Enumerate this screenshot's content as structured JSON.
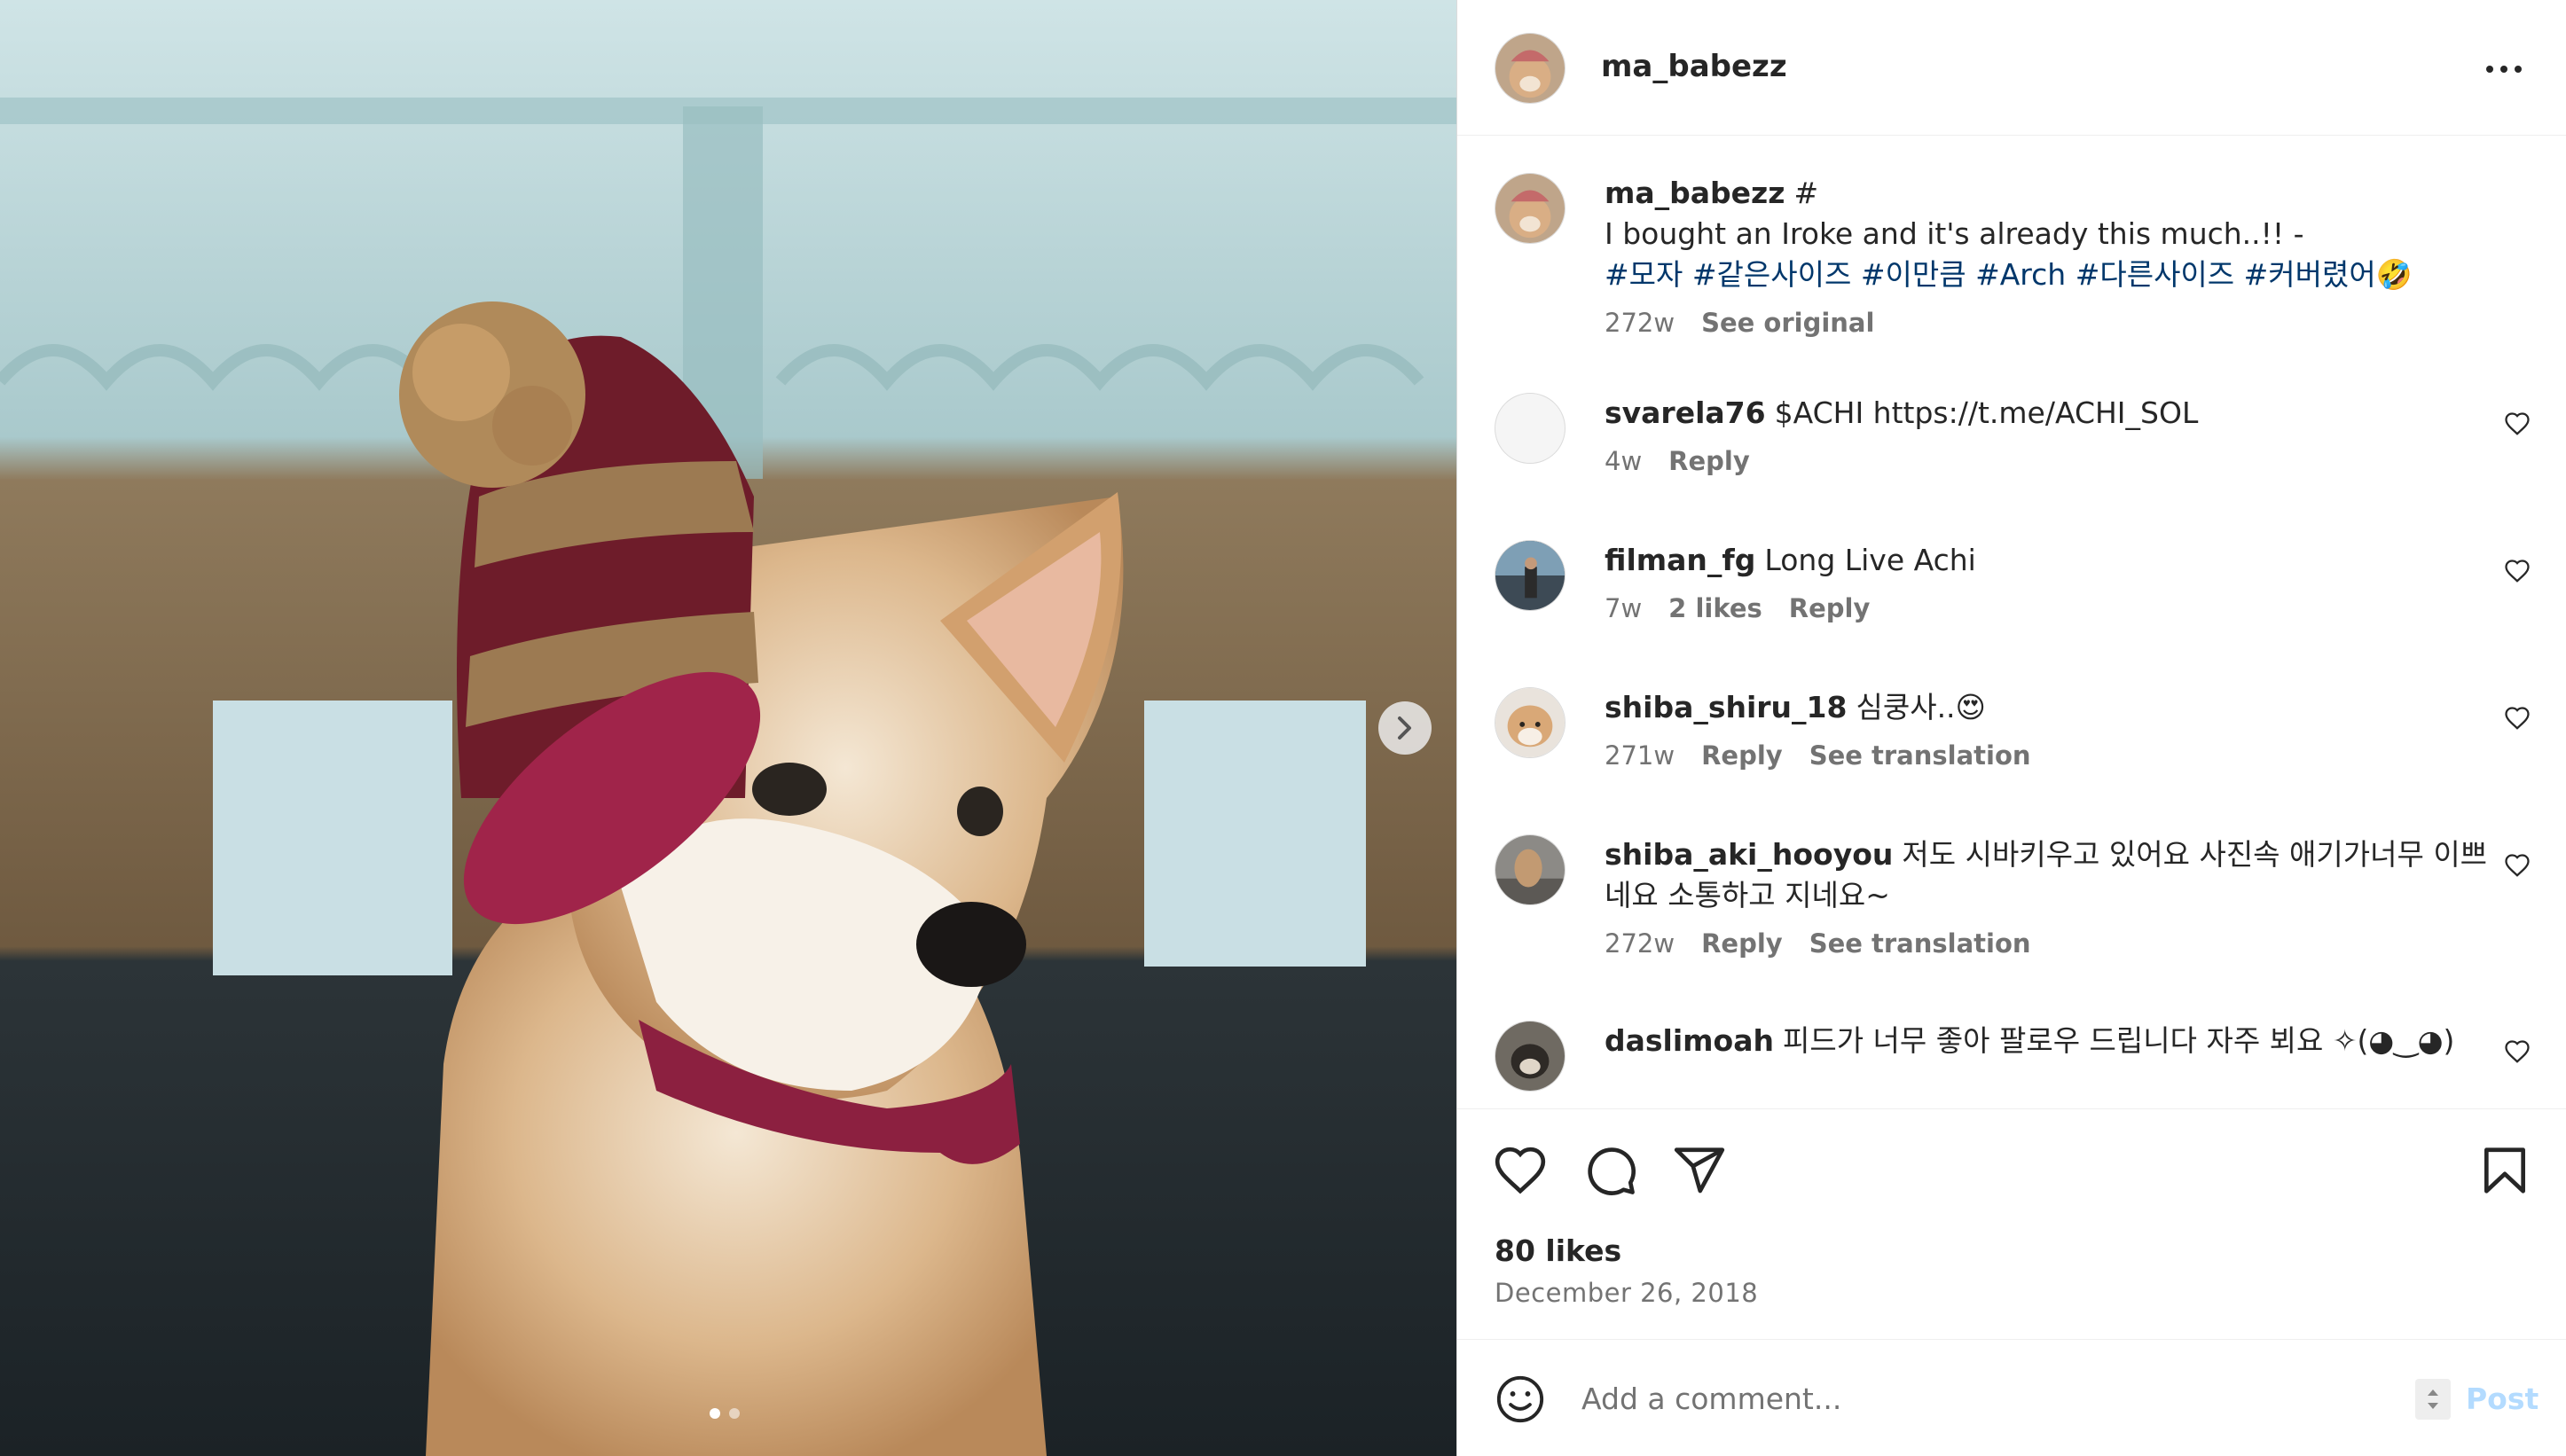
{
  "post": {
    "username": "ma_babezz",
    "likes": "80 likes",
    "date": "December 26, 2018",
    "carousel": {
      "total": 2,
      "active": 1
    }
  },
  "caption": {
    "username": "ma_babezz",
    "hash_mark": "#",
    "text": "I bought an Iroke and it's already this much..!! -",
    "hashtags": [
      "#모자",
      "#같은사이즈",
      "#이만큼",
      "#Arch",
      "#다른사이즈",
      "#커버렸어🤣"
    ],
    "time": "272w",
    "see_original": "See original"
  },
  "comments": [
    {
      "username": "svarela76",
      "text": "$ACHI https://t.me/ACHI_SOL",
      "time": "4w",
      "likes": "",
      "reply": "Reply",
      "translation": ""
    },
    {
      "username": "filman_fg",
      "text": "Long Live Achi",
      "time": "7w",
      "likes": "2 likes",
      "reply": "Reply",
      "translation": ""
    },
    {
      "username": "shiba_shiru_18",
      "text": "심쿵사..😍",
      "time": "271w",
      "likes": "",
      "reply": "Reply",
      "translation": "See translation"
    },
    {
      "username": "shiba_aki_hooyou",
      "text": "저도 시바키우고 있어요 사진속 애기가너무 이쁘네요 소통하고 지네요~",
      "time": "272w",
      "likes": "",
      "reply": "Reply",
      "translation": "See translation"
    },
    {
      "username": "daslimoah",
      "text": "피드가 너무 좋아 팔로우 드립니다 자주 뵈요 ✧(◕‿◕)",
      "time": "",
      "likes": "",
      "reply": "",
      "translation": ""
    }
  ],
  "add_comment": {
    "placeholder": "Add a comment...",
    "post_label": "Post"
  },
  "icons": {
    "more": "more-options-icon",
    "next": "chevron-right-icon",
    "like": "heart-icon",
    "comment": "comment-icon",
    "share": "send-icon",
    "save": "bookmark-icon",
    "emoji": "emoji-icon"
  },
  "colors": {
    "hashtag": "#00376b",
    "secondary_text": "#737373",
    "post_disabled": "#b3dbff"
  }
}
